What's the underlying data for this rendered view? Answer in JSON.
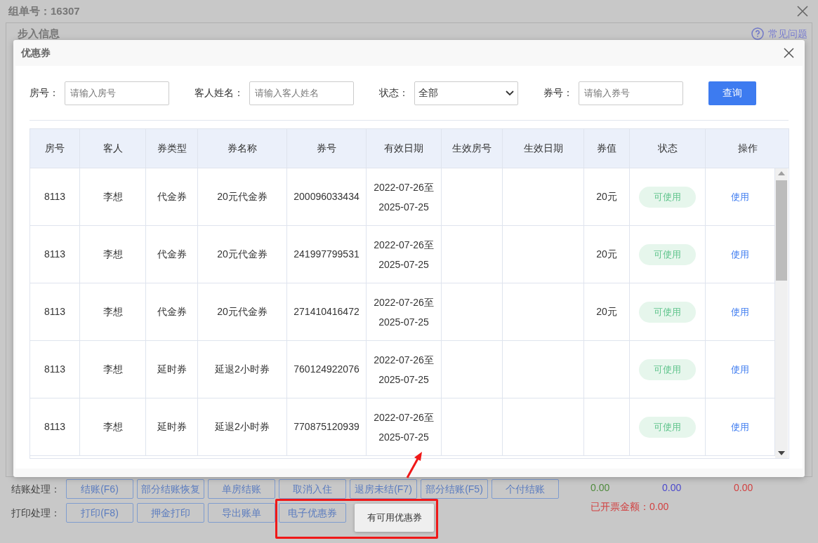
{
  "window": {
    "title": "组单号：16307",
    "section_title": "步入信息",
    "help_link": "常见问题"
  },
  "dialog": {
    "title": "优惠券",
    "filters": [
      {
        "kind": "input",
        "label": "房号：",
        "placeholder": "请输入房号"
      },
      {
        "kind": "input",
        "label": "客人姓名：",
        "placeholder": "请输入客人姓名"
      },
      {
        "kind": "select",
        "label": "状态：",
        "value": "全部"
      },
      {
        "kind": "input",
        "label": "券号：",
        "placeholder": "请输入券号"
      }
    ],
    "search_button": "查询",
    "table": {
      "columns": [
        "房号",
        "客人",
        "券类型",
        "券名称",
        "券号",
        "有效日期",
        "生效房号",
        "生效日期",
        "券值",
        "状态",
        "操作"
      ],
      "rows": [
        {
          "room": "8113",
          "guest": "李想",
          "type": "代金券",
          "name": "20元代金券",
          "code": "200096033434",
          "valid": [
            "2022-07-26至",
            "2025-07-25"
          ],
          "value": "20元",
          "status": "可使用",
          "action": "使用"
        },
        {
          "room": "8113",
          "guest": "李想",
          "type": "代金券",
          "name": "20元代金券",
          "code": "241997799531",
          "valid": [
            "2022-07-26至",
            "2025-07-25"
          ],
          "value": "20元",
          "status": "可使用",
          "action": "使用"
        },
        {
          "room": "8113",
          "guest": "李想",
          "type": "代金券",
          "name": "20元代金券",
          "code": "271410416472",
          "valid": [
            "2022-07-26至",
            "2025-07-25"
          ],
          "value": "20元",
          "status": "可使用",
          "action": "使用"
        },
        {
          "room": "8113",
          "guest": "李想",
          "type": "延时券",
          "name": "延退2小时券",
          "code": "760124922076",
          "valid": [
            "2022-07-26至",
            "2025-07-25"
          ],
          "status": "可使用",
          "action": "使用"
        },
        {
          "room": "8113",
          "guest": "李想",
          "type": "延时券",
          "name": "延退2小时券",
          "code": "770875120939",
          "valid": [
            "2022-07-26至",
            "2025-07-25"
          ],
          "status": "可使用",
          "action": "使用"
        }
      ]
    }
  },
  "checkout": {
    "label": "结账处理：",
    "buttons": [
      "结账(F6)",
      "部分结账恢复",
      "单房结账",
      "取消入住",
      "退房未结(F7)",
      "部分结账(F5)",
      "个付结账"
    ]
  },
  "print": {
    "label": "打印处理：",
    "buttons": [
      "打印(F8)",
      "押金打印",
      "导出账单",
      "电子优惠券"
    ]
  },
  "tooltip": "有可用优惠券",
  "amounts": [
    {
      "value": "0.00",
      "color": "#4e8a3c"
    },
    {
      "value": "0.00",
      "color": "#4a48cc"
    },
    {
      "value": "0.00",
      "color": "#d24040"
    }
  ],
  "invoiced": "已开票金额：0.00"
}
